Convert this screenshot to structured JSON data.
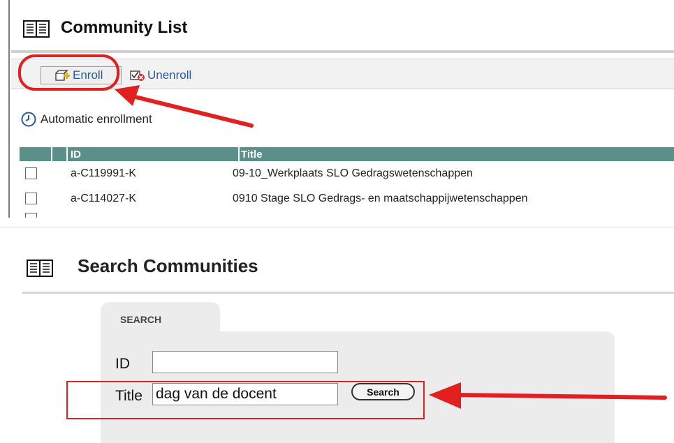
{
  "community_list": {
    "title": "Community List",
    "toolbar": {
      "enroll_label": "Enroll",
      "unenroll_label": "Unenroll"
    },
    "automatic_enrollment_label": "Automatic enrollment",
    "table": {
      "columns": [
        "ID",
        "Title"
      ],
      "rows": [
        {
          "id": "a-C119991-K",
          "title": "09-10_Werkplaats SLO Gedragswetenschappen"
        },
        {
          "id": "a-C114027-K",
          "title": "0910 Stage SLO Gedrags- en maatschappijwetenschappen"
        }
      ]
    },
    "header_color": "#5b8f8a",
    "link_color": "#2a5a96"
  },
  "search_communities": {
    "title": "Search Communities",
    "tab_label": "SEARCH",
    "fields": {
      "id_label": "ID",
      "id_value": "",
      "title_label": "Title",
      "title_value": "dag van de docent"
    },
    "search_button_label": "Search"
  },
  "annotations": {
    "highlight_color": "#e2201f"
  }
}
